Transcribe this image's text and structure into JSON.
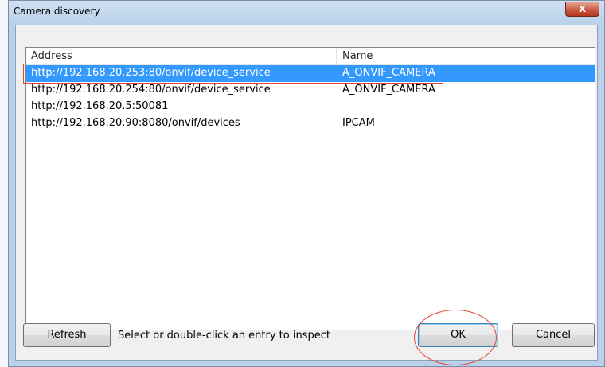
{
  "window": {
    "title": "Camera discovery",
    "close_glyph": "x"
  },
  "list": {
    "columns": [
      "Address",
      "Name"
    ],
    "rows": [
      {
        "address": "http://192.168.20.253:80/onvif/device_service",
        "name": "A_ONVIF_CAMERA",
        "selected": true
      },
      {
        "address": "http://192.168.20.254:80/onvif/device_service",
        "name": "A_ONVIF_CAMERA",
        "selected": false
      },
      {
        "address": "http://192.168.20.5:50081",
        "name": "",
        "selected": false
      },
      {
        "address": "http://192.168.20.90:8080/onvif/devices",
        "name": "IPCAM",
        "selected": false
      }
    ]
  },
  "footer": {
    "refresh_label": "Refresh",
    "status": "Select or double-click an entry to inspect",
    "ok_label": "OK",
    "cancel_label": "Cancel"
  },
  "colors": {
    "selection": "#3399ff",
    "annotation": "#e0453c"
  }
}
